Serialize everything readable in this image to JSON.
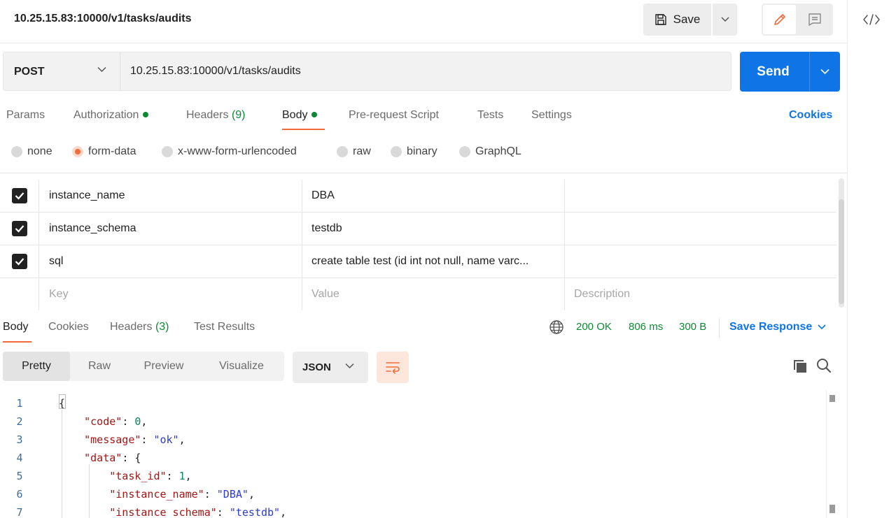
{
  "request": {
    "title": "10.25.15.83:10000/v1/tasks/audits",
    "method": "POST",
    "url": "10.25.15.83:10000/v1/tasks/audits"
  },
  "toolbar": {
    "save_label": "Save",
    "send_label": "Send"
  },
  "tabs": {
    "params": "Params",
    "authorization": "Authorization",
    "headers": "Headers",
    "headers_count": "(9)",
    "body": "Body",
    "pre_request": "Pre-request Script",
    "tests": "Tests",
    "settings": "Settings",
    "cookies": "Cookies"
  },
  "body_types": [
    "none",
    "form-data",
    "x-www-form-urlencoded",
    "raw",
    "binary",
    "GraphQL"
  ],
  "body_type_selected": "form-data",
  "params": [
    {
      "key": "instance_name",
      "value": "DBA",
      "description": "",
      "checked": true
    },
    {
      "key": "instance_schema",
      "value": "testdb",
      "description": "",
      "checked": true
    },
    {
      "key": "sql",
      "value": "create table test (id int not null, name varc...",
      "description": "",
      "checked": true
    }
  ],
  "params_placeholder": {
    "key": "Key",
    "value": "Value",
    "description": "Description"
  },
  "response": {
    "tabs": {
      "body": "Body",
      "cookies": "Cookies",
      "headers": "Headers",
      "headers_count": "(3)",
      "test_results": "Test Results"
    },
    "status": "200 OK",
    "time": "806 ms",
    "size": "300 B",
    "save_response": "Save Response",
    "views": [
      "Pretty",
      "Raw",
      "Preview",
      "Visualize"
    ],
    "active_view": "Pretty",
    "format": "JSON"
  },
  "code_lines": [
    {
      "n": "1",
      "tokens": [
        [
          "p",
          "{"
        ]
      ]
    },
    {
      "n": "2",
      "tokens": [
        [
          "p",
          "    "
        ],
        [
          "k",
          "\"code\""
        ],
        [
          "p",
          ": "
        ],
        [
          "n",
          "0"
        ],
        [
          "p",
          ","
        ]
      ]
    },
    {
      "n": "3",
      "tokens": [
        [
          "p",
          "    "
        ],
        [
          "k",
          "\"message\""
        ],
        [
          "p",
          ": "
        ],
        [
          "s",
          "\"ok\""
        ],
        [
          "p",
          ","
        ]
      ]
    },
    {
      "n": "4",
      "tokens": [
        [
          "p",
          "    "
        ],
        [
          "k",
          "\"data\""
        ],
        [
          "p",
          ": {"
        ]
      ]
    },
    {
      "n": "5",
      "tokens": [
        [
          "p",
          "        "
        ],
        [
          "k",
          "\"task_id\""
        ],
        [
          "p",
          ": "
        ],
        [
          "n",
          "1"
        ],
        [
          "p",
          ","
        ]
      ]
    },
    {
      "n": "6",
      "tokens": [
        [
          "p",
          "        "
        ],
        [
          "k",
          "\"instance_name\""
        ],
        [
          "p",
          ": "
        ],
        [
          "s",
          "\"DBA\""
        ],
        [
          "p",
          ","
        ]
      ]
    },
    {
      "n": "7",
      "tokens": [
        [
          "p",
          "        "
        ],
        [
          "k",
          "\"instance_schema\""
        ],
        [
          "p",
          ": "
        ],
        [
          "s",
          "\"testdb\""
        ],
        [
          "p",
          ","
        ]
      ]
    }
  ],
  "colors": {
    "accent": "#f26b3a",
    "primary": "#0f74e6",
    "success": "#0c8a33"
  }
}
